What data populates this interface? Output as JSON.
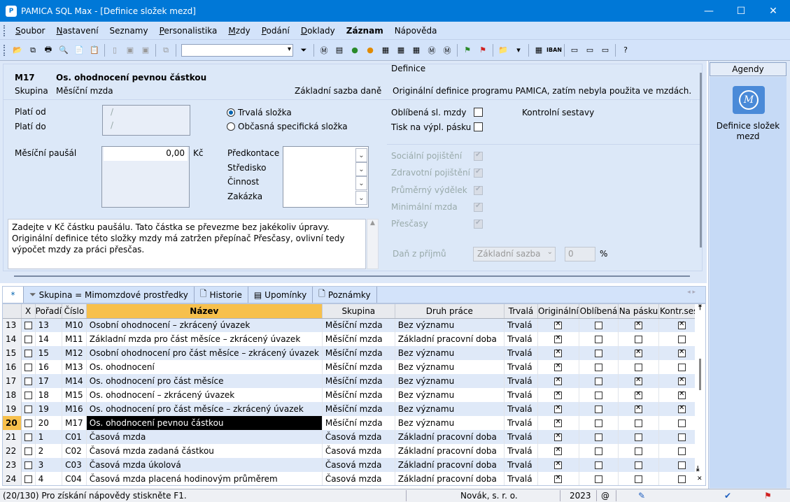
{
  "window": {
    "title": "PAMICA SQL Max - [Definice složek mezd]",
    "app_icon": "pamica-app-icon"
  },
  "menu": [
    {
      "label": "Soubor",
      "key": "S",
      "rest": "oubor"
    },
    {
      "label": "Nastavení",
      "key": "N",
      "rest": "astavení"
    },
    {
      "label": "Seznamy",
      "key": "",
      "rest": "Seznamy"
    },
    {
      "label": "Personalistika",
      "key": "P",
      "rest": "ersonalistika"
    },
    {
      "label": "Mzdy",
      "key": "M",
      "rest": "zdy"
    },
    {
      "label": "Podání",
      "key": "P",
      "rest": "odání"
    },
    {
      "label": "Doklady",
      "key": "D",
      "rest": "oklady"
    },
    {
      "label": "Záznam",
      "key": "",
      "rest": "Záznam"
    },
    {
      "label": "Nápověda",
      "key": "",
      "rest": "Nápověda"
    }
  ],
  "form": {
    "code": "M17",
    "name": "Os. ohodnocení pevnou částkou",
    "group_label": "Skupina",
    "group_value": "Měsíční mzda",
    "tax_base": "Základní sazba daně",
    "valid_from_label": "Platí od",
    "valid_to_label": "Platí do",
    "valid_from": "/",
    "valid_to": "/",
    "radio_permanent": "Trvalá složka",
    "radio_occasional": "Občasná specifická složka",
    "monthly_label": "Měsíční paušál",
    "monthly_value": "0,00",
    "currency": "Kč",
    "predkontace": "Předkontace",
    "stredisko": "Středisko",
    "cinnost": "Činnost",
    "zakazka": "Zakázka",
    "help_text": "Zadejte v Kč částku paušálu. Tato částka se převezme bez jakékoliv úpravy. Originální definice této složky mzdy má zatržen přepínač Přesčasy, ovlivní tedy výpočet mzdy za práci přesčas.",
    "definice_label": "Definice",
    "definice_text": "Originální definice programu PAMICA, zatím nebyla použita ve mzdách.",
    "oblibena": "Oblíbená sl. mzdy",
    "tisk": "Tisk na výpl. pásku",
    "kontrolni": "Kontrolní sestavy",
    "soc": "Sociální pojištění",
    "zdrav": "Zdravotní pojištění",
    "prumerny": "Průměrný výdělek",
    "minimalni": "Minimální mzda",
    "prescasy": "Přesčasy",
    "dan_label": "Daň z příjmů",
    "dan_value": "Základní sazba",
    "dan_pct": "0",
    "pct": "%"
  },
  "agendy": {
    "header": "Agendy",
    "item": "Definice složek mezd"
  },
  "tabs": [
    {
      "label": "*"
    },
    {
      "label": "Skupina = Mimomzdové prostředky"
    },
    {
      "label": "Historie"
    },
    {
      "label": "Upomínky"
    },
    {
      "label": "Poznámky"
    }
  ],
  "grid": {
    "columns": [
      "X",
      "Pořadí",
      "Číslo",
      "Název",
      "Skupina",
      "Druh práce",
      "Trvalá",
      "Originální",
      "Oblíbená",
      "Na pásku",
      "Kontr.sest."
    ],
    "rows": [
      {
        "rn": "13",
        "x": false,
        "poradi": "13",
        "cislo": "M10",
        "nazev": "Osobní ohodnocení – zkrácený úvazek",
        "skupina": "Měsíční mzda",
        "druh": "Bez významu",
        "trvala": "Trvalá",
        "orig": true,
        "obl": false,
        "pasek": true,
        "kontr": true
      },
      {
        "rn": "14",
        "x": false,
        "poradi": "14",
        "cislo": "M11",
        "nazev": "Základní mzda pro část měsíce – zkrácený úvazek",
        "skupina": "Měsíční mzda",
        "druh": "Základní pracovní doba",
        "trvala": "Trvalá",
        "orig": true,
        "obl": false,
        "pasek": false,
        "kontr": false
      },
      {
        "rn": "15",
        "x": false,
        "poradi": "15",
        "cislo": "M12",
        "nazev": "Osobní ohodnocení pro část měsíce – zkrácený úvazek",
        "skupina": "Měsíční mzda",
        "druh": "Bez významu",
        "trvala": "Trvalá",
        "orig": true,
        "obl": false,
        "pasek": true,
        "kontr": true
      },
      {
        "rn": "16",
        "x": false,
        "poradi": "16",
        "cislo": "M13",
        "nazev": "Os. ohodnocení",
        "skupina": "Měsíční mzda",
        "druh": "Bez významu",
        "trvala": "Trvalá",
        "orig": true,
        "obl": false,
        "pasek": false,
        "kontr": false
      },
      {
        "rn": "17",
        "x": false,
        "poradi": "17",
        "cislo": "M14",
        "nazev": "Os. ohodnocení pro část měsíce",
        "skupina": "Měsíční mzda",
        "druh": "Bez významu",
        "trvala": "Trvalá",
        "orig": true,
        "obl": false,
        "pasek": true,
        "kontr": true
      },
      {
        "rn": "18",
        "x": false,
        "poradi": "18",
        "cislo": "M15",
        "nazev": "Os. ohodnocení – zkrácený úvazek",
        "skupina": "Měsíční mzda",
        "druh": "Bez významu",
        "trvala": "Trvalá",
        "orig": true,
        "obl": false,
        "pasek": true,
        "kontr": true
      },
      {
        "rn": "19",
        "x": false,
        "poradi": "19",
        "cislo": "M16",
        "nazev": "Os. ohodnocení pro část měsíce – zkrácený úvazek",
        "skupina": "Měsíční mzda",
        "druh": "Bez významu",
        "trvala": "Trvalá",
        "orig": true,
        "obl": false,
        "pasek": true,
        "kontr": true
      },
      {
        "rn": "20",
        "x": false,
        "poradi": "20",
        "cislo": "M17",
        "nazev": "Os. ohodnocení pevnou částkou",
        "skupina": "Měsíční mzda",
        "druh": "Bez významu",
        "trvala": "Trvalá",
        "orig": true,
        "obl": false,
        "pasek": false,
        "kontr": false,
        "selected": true
      },
      {
        "rn": "21",
        "x": false,
        "poradi": "1",
        "cislo": "C01",
        "nazev": "Časová mzda",
        "skupina": "Časová mzda",
        "druh": "Základní pracovní doba",
        "trvala": "Trvalá",
        "orig": true,
        "obl": false,
        "pasek": false,
        "kontr": false
      },
      {
        "rn": "22",
        "x": false,
        "poradi": "2",
        "cislo": "C02",
        "nazev": "Časová mzda zadaná částkou",
        "skupina": "Časová mzda",
        "druh": "Základní pracovní doba",
        "trvala": "Trvalá",
        "orig": true,
        "obl": false,
        "pasek": false,
        "kontr": false
      },
      {
        "rn": "23",
        "x": false,
        "poradi": "3",
        "cislo": "C03",
        "nazev": "Časová mzda úkolová",
        "skupina": "Časová mzda",
        "druh": "Základní pracovní doba",
        "trvala": "Trvalá",
        "orig": true,
        "obl": false,
        "pasek": false,
        "kontr": false
      },
      {
        "rn": "24",
        "x": false,
        "poradi": "4",
        "cislo": "C04",
        "nazev": "Časová mzda placená hodinovým průměrem",
        "skupina": "Časová mzda",
        "druh": "Základní pracovní doba",
        "trvala": "Trvalá",
        "orig": true,
        "obl": false,
        "pasek": false,
        "kontr": false
      }
    ]
  },
  "status": {
    "left": "(20/130) Pro získání nápovědy stiskněte F1.",
    "company": "Novák, s. r. o.",
    "year": "2023",
    "at": "@"
  }
}
